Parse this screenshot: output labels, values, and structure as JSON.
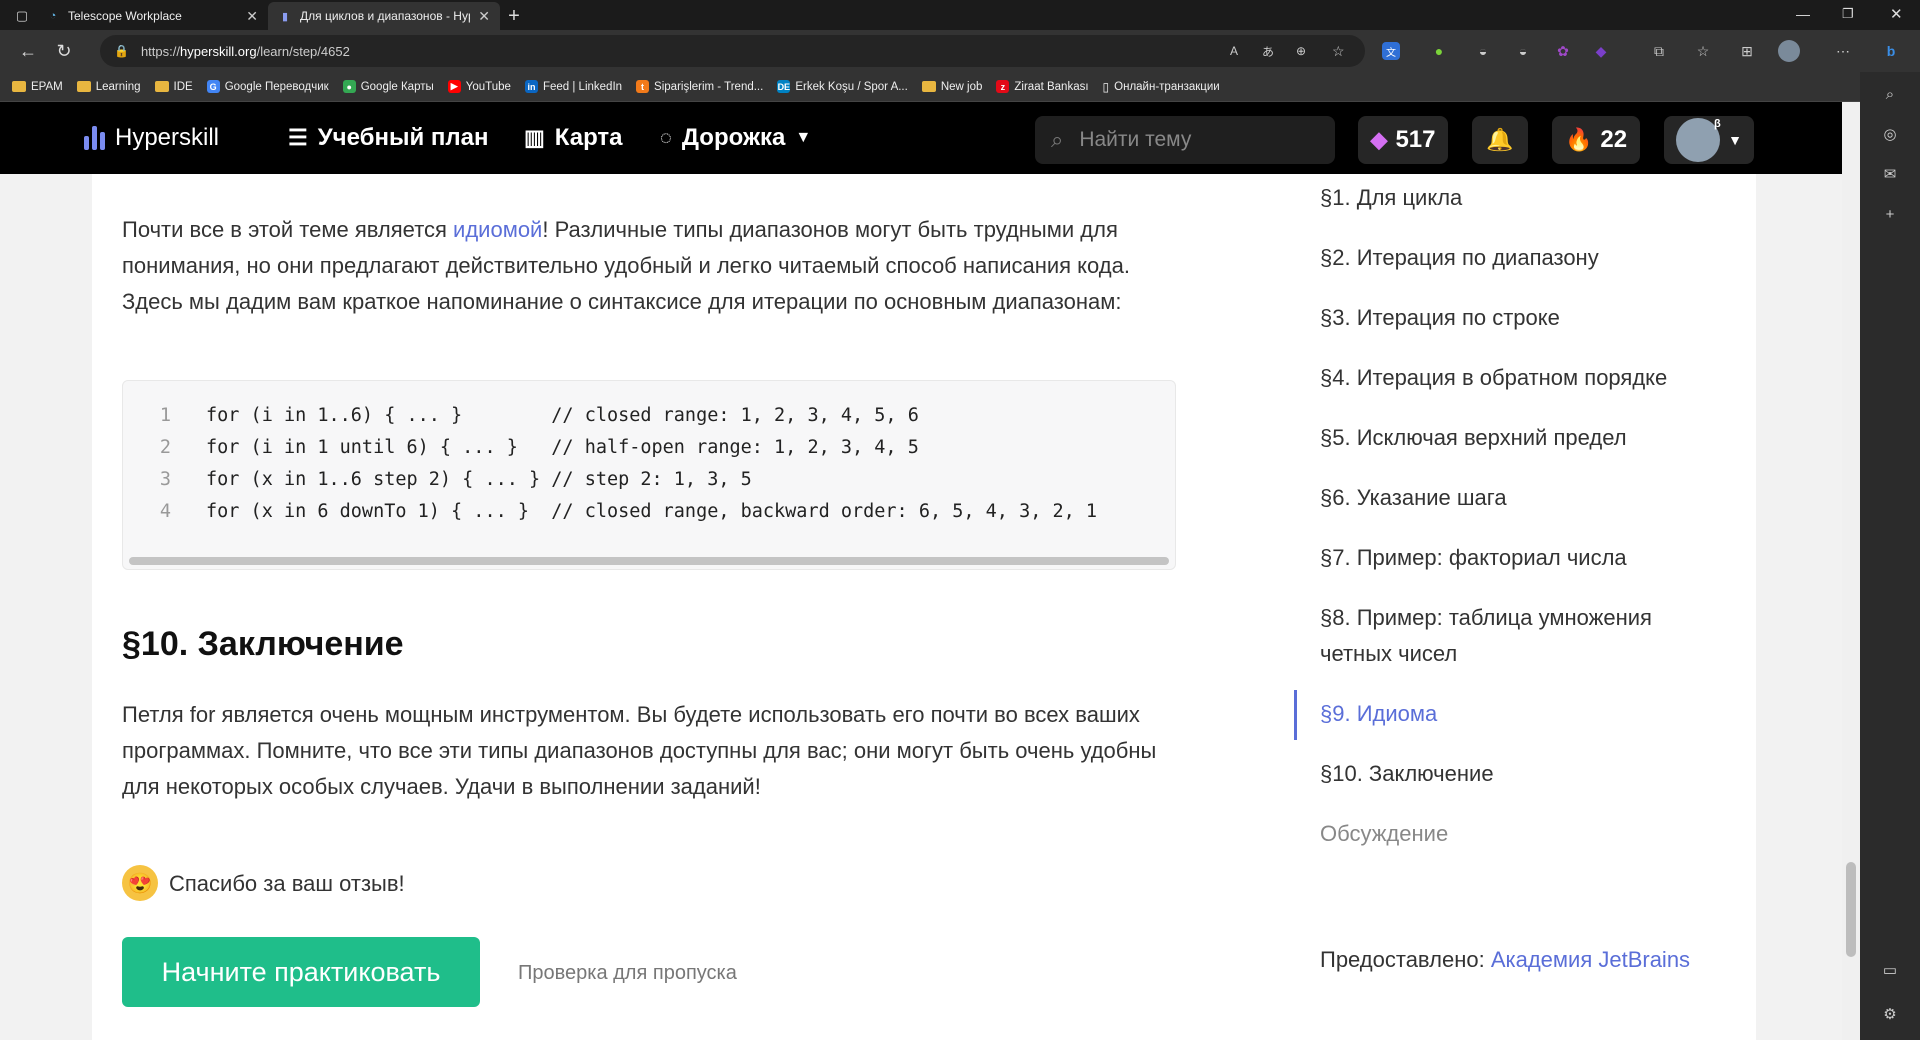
{
  "browser": {
    "tabs": [
      {
        "title": "Telescope Workplace",
        "icon": "telescope-icon"
      },
      {
        "title": "Для циклов и диапазонов - Hyp",
        "icon": "hyperskill-icon"
      }
    ],
    "url_prefix": "https://",
    "url_host": "hyperskill.org",
    "url_path": "/learn/step/4652",
    "bookmarks": [
      "EPAM",
      "Learning",
      "IDE",
      "Google Переводчик",
      "Google Карты",
      "YouTube",
      "Feed | LinkedIn",
      "Siparişlerim - Trend...",
      "Erkek Koşu / Spor A...",
      "New job",
      "Ziraat Bankası",
      "Онлайн-транзакции"
    ]
  },
  "header": {
    "logo": "Hyperskill",
    "nav": [
      "Учебный план",
      "Карта",
      "Дорожка"
    ],
    "search_placeholder": "Найти тему",
    "gems": "517",
    "streak": "22",
    "avatar_badge": "β"
  },
  "content": {
    "intro_pre": "Почти все в этой теме является ",
    "intro_link": "идиомой",
    "intro_post": "! Различные типы диапазонов могут быть трудными для понимания, но они предлагают действительно удобный и легко читаемый способ написания кода. Здесь мы дадим вам краткое напоминание о синтаксисе для итерации по основным диапазонам:",
    "code_lines": [
      {
        "n": "1",
        "code": "for (i in 1..6) { ... }        // closed range: 1, 2, 3, 4, 5, 6"
      },
      {
        "n": "2",
        "code": "for (i in 1 until 6) { ... }   // half-open range: 1, 2, 3, 4, 5"
      },
      {
        "n": "3",
        "code": "for (x in 1..6 step 2) { ... } // step 2: 1, 3, 5"
      },
      {
        "n": "4",
        "code": "for (x in 6 downTo 1) { ... }  // closed range, backward order: 6, 5, 4, 3, 2, 1"
      }
    ],
    "section_title": "§10. Заключение",
    "conclusion": "Петля for является очень мощным инструментом. Вы будете использовать его почти во всех ваших программах. Помните, что все эти типы диапазонов доступны для вас; они могут быть очень удобны для некоторых особых случаев. Удачи в выполнении заданий!",
    "thanks": "Спасибо за ваш отзыв!",
    "practice_button": "Начните практиковать",
    "skip_link": "Проверка для пропуска",
    "provided_label": "Предоставлено: ",
    "provided_link": "Академия JetBrains"
  },
  "toc": [
    "§1. Для цикла",
    "§2. Итерация по диапазону",
    "§3. Итерация по строке",
    "§4. Итерация в обратном порядке",
    "§5. Исключая верхний предел",
    "§6. Указание шага",
    "§7. Пример: факториал числа",
    "§8. Пример: таблица умножения",
    "четных чисел",
    "§9. Идиома",
    "§10. Заключение",
    "Обсуждение"
  ],
  "colors": {
    "accent": "#5a6ed8",
    "practice": "#1fbe8a",
    "header": "#000000"
  }
}
